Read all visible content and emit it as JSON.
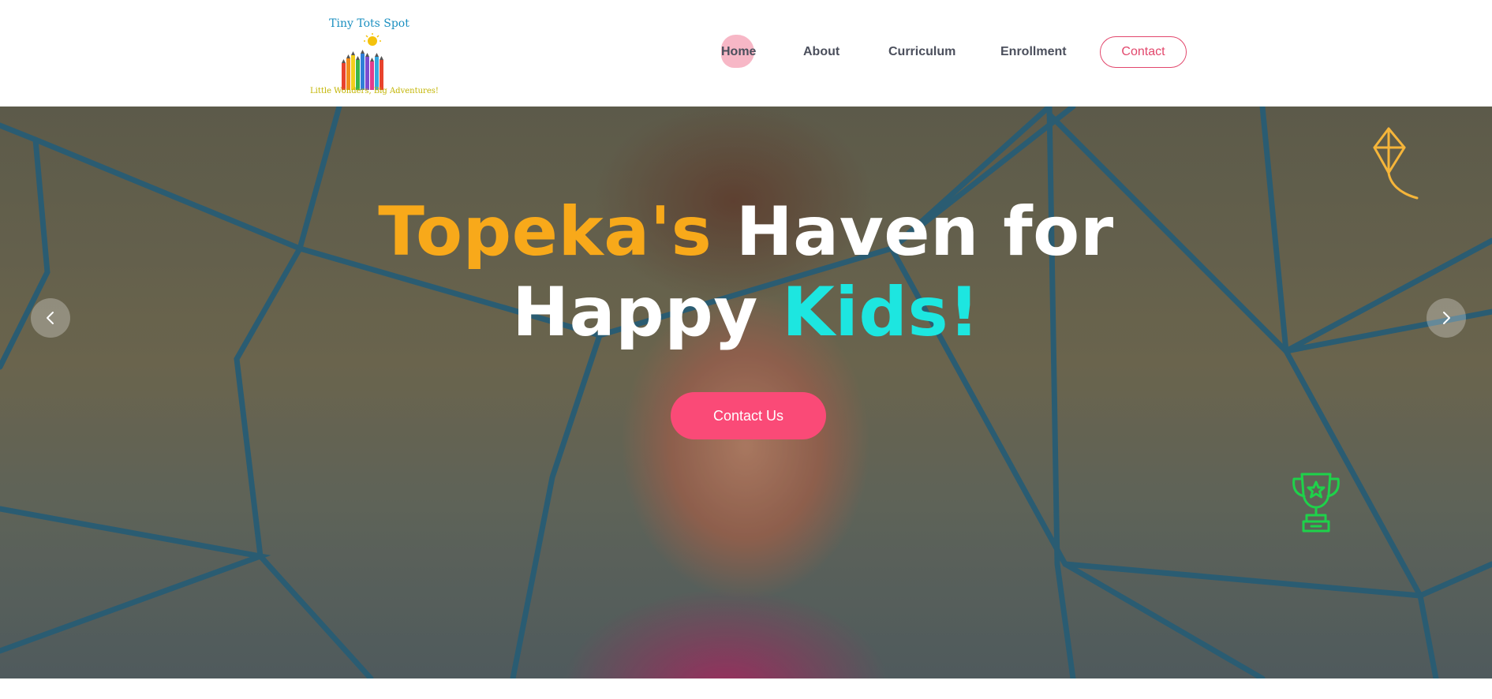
{
  "brand": {
    "name": "Tiny Tots Spot",
    "tagline": "Little Wonders, Big Adventures!"
  },
  "nav": {
    "home": "Home",
    "about": "About",
    "curriculum": "Curriculum",
    "enrollment": "Enrollment",
    "contact": "Contact"
  },
  "hero": {
    "title_part1": "Topeka's",
    "title_part2": " Haven for",
    "title_part3": "Happy ",
    "title_part4": "Kids!",
    "cta_label": "Contact Us"
  },
  "icons": {
    "prev": "chevron-left-icon",
    "next": "chevron-right-icon",
    "decor1": "kite-icon",
    "decor2": "trophy-icon"
  },
  "colors": {
    "accent_pink": "#fa4a77",
    "contact_outline": "#e2476c",
    "title_yellow": "#f8a91a",
    "title_cyan": "#1de6e0",
    "kite": "#f5b53a",
    "trophy": "#1ed24a"
  }
}
